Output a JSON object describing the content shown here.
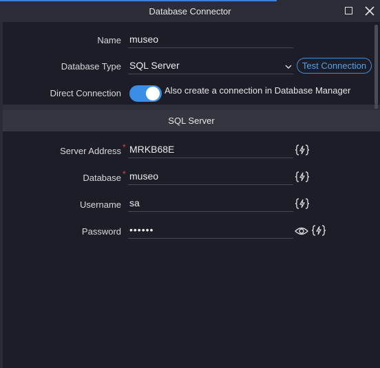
{
  "window": {
    "title": "Database Connector"
  },
  "connection": {
    "name_label": "Name",
    "name_value": "museo",
    "type_label": "Database Type",
    "type_value": "SQL Server",
    "test_button": "Test Connection",
    "direct_label": "Direct Connection",
    "direct_enabled": true,
    "direct_toggle_text": "Also create a connection in Database Manager"
  },
  "section": {
    "title": "SQL Server"
  },
  "server": {
    "address_label": "Server Address",
    "address_value": "MRKB68E",
    "database_label": "Database",
    "database_value": "museo",
    "username_label": "Username",
    "username_value": "sa",
    "password_label": "Password",
    "password_value": "••••••",
    "required_marker": "*"
  },
  "icons": {
    "dynamic_value": "dynamic-data-icon",
    "show_password": "eye-icon",
    "maximize": "maximize-icon",
    "close": "close-icon",
    "dropdown": "chevron-down-icon"
  },
  "colors": {
    "accent": "#3b8ee6",
    "required": "#e0453f",
    "background": "#1c1d27",
    "section_header": "#34353e"
  }
}
